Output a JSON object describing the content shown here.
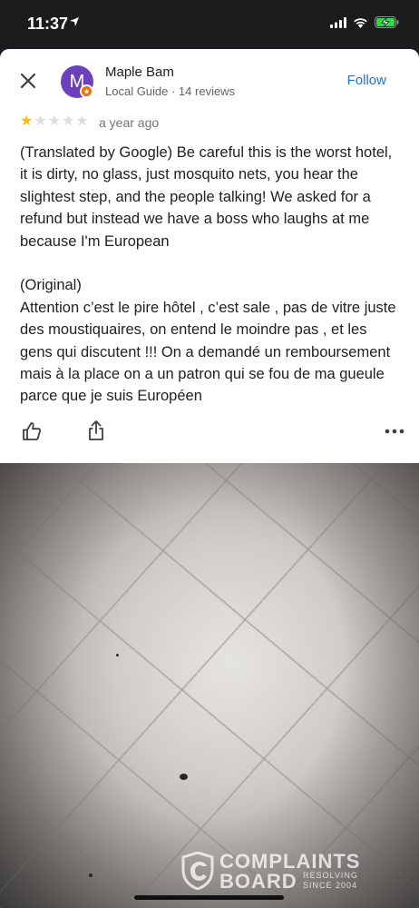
{
  "status_bar": {
    "time": "11:37",
    "icons": [
      "location-arrow-icon",
      "signal-icon",
      "wifi-icon",
      "battery-charging-icon"
    ]
  },
  "review": {
    "reviewer": {
      "initial": "M",
      "name": "Maple Bam",
      "meta": "Local Guide · 14 reviews"
    },
    "follow_label": "Follow",
    "rating": 1,
    "max_rating": 5,
    "date": "a year ago",
    "translated_text": "(Translated by Google) Be careful this is the worst hotel, it is dirty, no glass, just mosquito nets, you hear the slightest step, and the people talking! We asked for a refund but instead we have a boss who laughs at me because I'm European",
    "original_label": "(Original)",
    "original_text": "Attention c’est le pire hôtel , c’est sale , pas de vitre juste des moustiquaires, on entend le moindre pas , et les gens qui discutent !!! On a demandé un remboursement mais à la place on a un patron qui se fou de ma gueule parce que je suis Européen"
  },
  "watermark": {
    "line1": "COMPLAINTS",
    "line2": "BOARD",
    "tag1": "RESOLVING",
    "tag2": "SINCE 2004"
  },
  "colors": {
    "accent": "#1a73e8",
    "star_on": "#fbbc04",
    "star_off": "#dadce0",
    "avatar": "#6c3fbd",
    "badge": "#e8710a"
  }
}
